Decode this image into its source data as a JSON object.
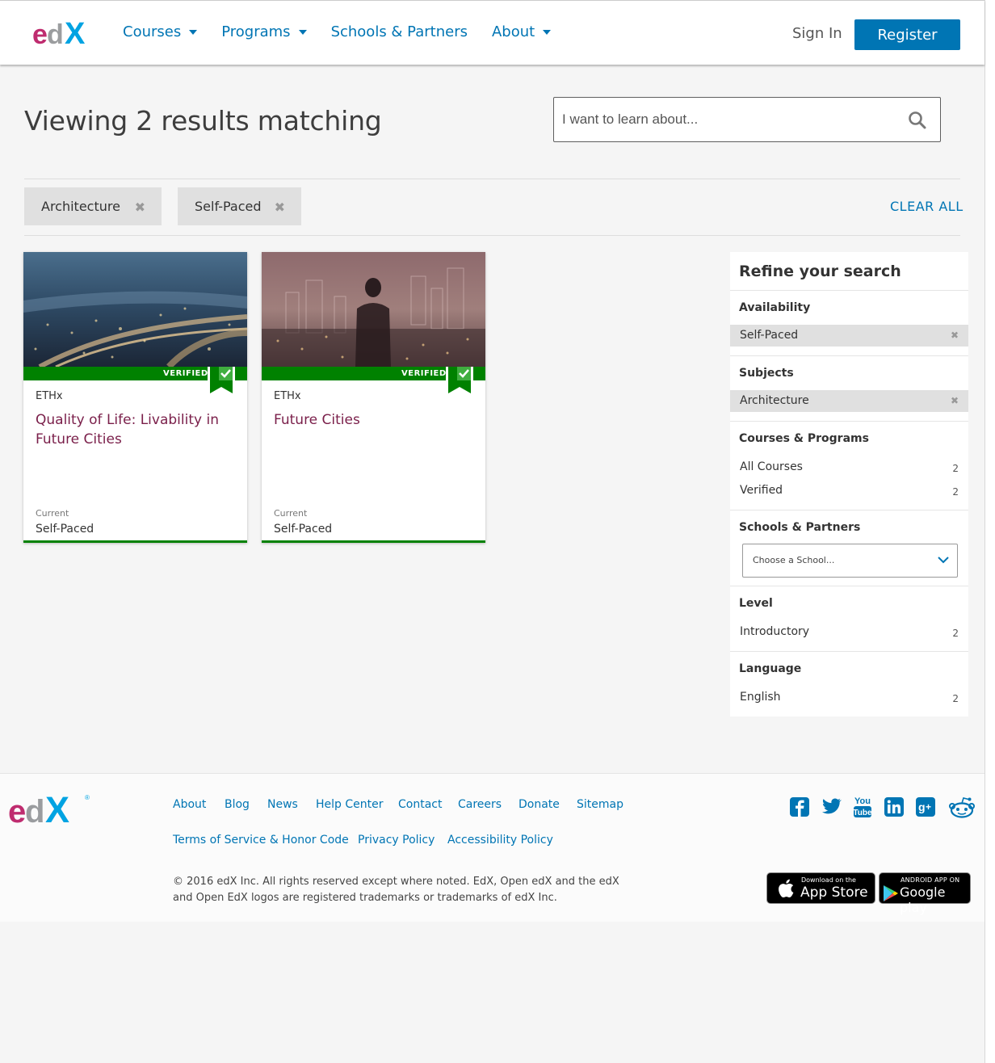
{
  "header": {
    "nav": [
      {
        "label": "Courses",
        "caret": true
      },
      {
        "label": "Programs",
        "caret": true
      },
      {
        "label": "Schools & Partners",
        "caret": false
      },
      {
        "label": "About",
        "caret": true
      }
    ],
    "sign_in": "Sign In",
    "register": "Register"
  },
  "search": {
    "heading": "Viewing 2 results matching",
    "placeholder": "I want to learn about..."
  },
  "filters": {
    "active": [
      "Architecture",
      "Self-Paced"
    ],
    "clear_all": "CLEAR ALL"
  },
  "courses": [
    {
      "badge": "VERIFIED",
      "org": "ETHx",
      "title": "Quality of Life: Livability in Future Cities",
      "status_label": "Current",
      "status": "Self-Paced"
    },
    {
      "badge": "VERIFIED",
      "org": "ETHx",
      "title": "Future Cities",
      "status_label": "Current",
      "status": "Self-Paced"
    }
  ],
  "refine": {
    "title": "Refine your search",
    "availability": {
      "title": "Availability",
      "active": "Self-Paced"
    },
    "subjects": {
      "title": "Subjects",
      "active": "Architecture"
    },
    "courses_programs": {
      "title": "Courses & Programs",
      "items": [
        {
          "label": "All Courses",
          "count": "2"
        },
        {
          "label": "Verified",
          "count": "2"
        }
      ]
    },
    "schools": {
      "title": "Schools & Partners",
      "select_placeholder": "Choose a School..."
    },
    "level": {
      "title": "Level",
      "items": [
        {
          "label": "Introductory",
          "count": "2"
        }
      ]
    },
    "language": {
      "title": "Language",
      "items": [
        {
          "label": "English",
          "count": "2"
        }
      ]
    }
  },
  "footer": {
    "links_row1": [
      "About",
      "Blog",
      "News",
      "Help Center",
      "Contact",
      "Careers",
      "Donate",
      "Sitemap"
    ],
    "links_row2": [
      "Terms of Service & Honor Code",
      "Privacy Policy",
      "Accessibility Policy"
    ],
    "copyright": "© 2016 edX Inc. All rights reserved except where noted. EdX, Open edX and the edX and Open EdX logos are registered trademarks or trademarks of edX Inc.",
    "social_icons": [
      "facebook-icon",
      "twitter-icon",
      "youtube-icon",
      "linkedin-icon",
      "google-plus-icon",
      "reddit-icon"
    ],
    "app_store": {
      "small": "Download on the",
      "big": "App Store"
    },
    "google_play": {
      "small": "ANDROID APP ON",
      "big": "Google play"
    }
  },
  "colors": {
    "brand_blue": "#0075b4",
    "verified_green": "#008100",
    "title_maroon": "#7a1f4a",
    "logo_pink": "#bf2c6f",
    "logo_grey": "#8a8c8f",
    "logo_cyan": "#00a3e2"
  }
}
